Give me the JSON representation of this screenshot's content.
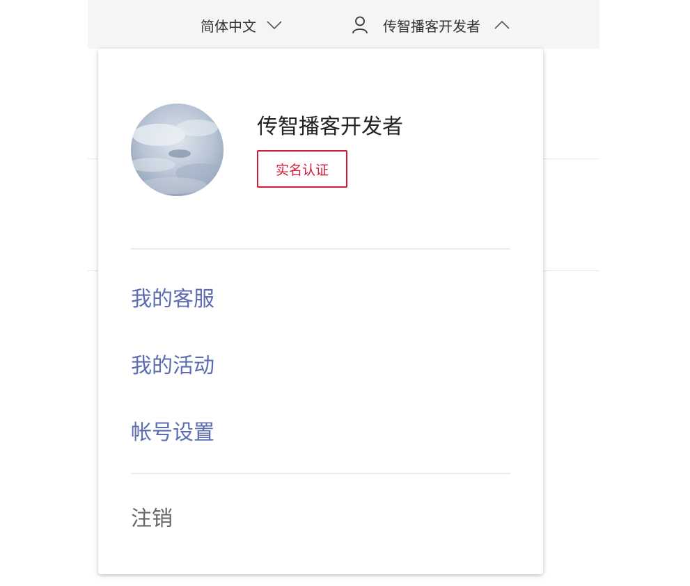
{
  "header": {
    "language_label": "简体中文",
    "user_label": "传智播客开发者"
  },
  "profile": {
    "name": "传智播客开发者",
    "verify_badge": "实名认证"
  },
  "menu": {
    "items": [
      {
        "label": "我的客服"
      },
      {
        "label": "我的活动"
      },
      {
        "label": "帐号设置"
      }
    ],
    "logout_label": "注销"
  },
  "colors": {
    "accent": "#5b6cb3",
    "badge_red": "#d51b3a",
    "topbar_bg": "#f5f5f5"
  },
  "icons": {
    "language_toggle": "chevron-down-icon",
    "user": "user-icon",
    "user_toggle": "chevron-up-icon"
  }
}
